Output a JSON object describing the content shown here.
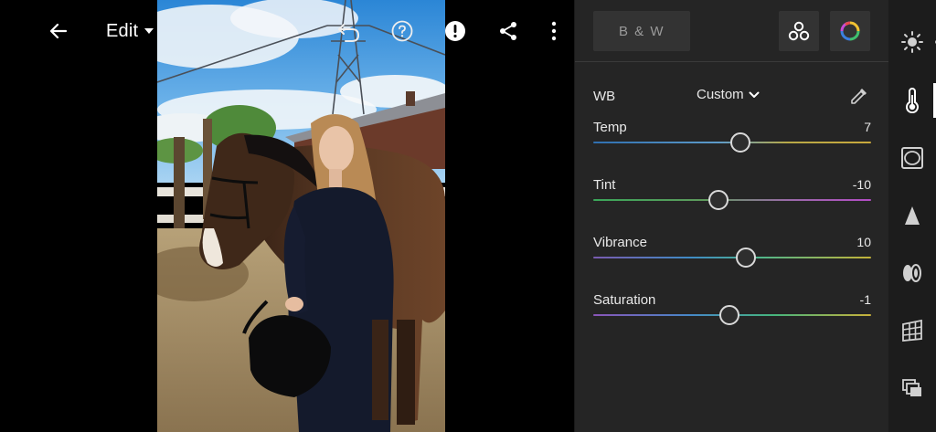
{
  "topbar": {
    "edit_label": "Edit"
  },
  "panel": {
    "bw_label": "B & W",
    "wb": {
      "label": "WB",
      "value": "Custom"
    },
    "sliders": [
      {
        "name": "Temp",
        "value": "7",
        "position": 0.53
      },
      {
        "name": "Tint",
        "value": "-10",
        "position": 0.45
      },
      {
        "name": "Vibrance",
        "value": "10",
        "position": 0.55
      },
      {
        "name": "Saturation",
        "value": "-1",
        "position": 0.49
      }
    ]
  },
  "icons": {
    "back": "arrow-left-icon",
    "dropdown": "caret-down-icon",
    "undo": "undo-icon",
    "help": "question-circle-icon",
    "alert": "exclamation-circle-icon",
    "share": "share-icon",
    "more": "more-vertical-icon",
    "profiles": "profiles-icon",
    "color_mix": "color-wheel-icon",
    "eyedropper": "eyedropper-icon",
    "rail": [
      "light-icon",
      "color-thermometer-icon",
      "effects-icon",
      "detail-icon",
      "optics-icon",
      "geometry-icon",
      "versions-icon"
    ]
  },
  "colors": {
    "panel_bg": "#252525",
    "rail_bg": "#1c1c1c",
    "canvas_bg": "#000000",
    "thumb_border": "#d9d9d9"
  }
}
